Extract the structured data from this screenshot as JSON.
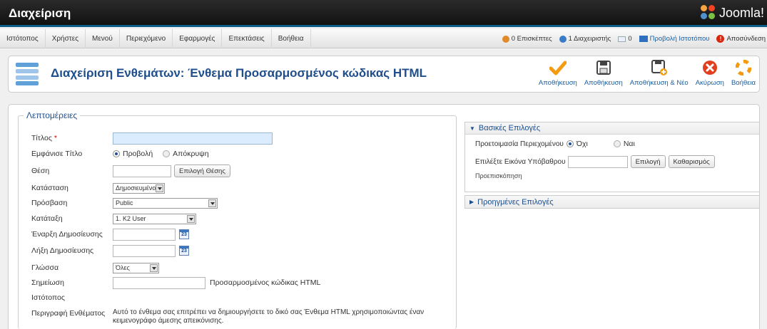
{
  "header": {
    "title": "Διαχείριση",
    "logo_text": "Joomla!"
  },
  "menu": [
    "Ιστότοπος",
    "Χρήστες",
    "Μενού",
    "Περιεχόμενο",
    "Εφαρμογές",
    "Επεκτάσεις",
    "Βοήθεια"
  ],
  "status": {
    "visitors": "0 Επισκέπτες",
    "admins": "1 Διαχειριστής",
    "messages": "0",
    "preview": "Προβολή Ιστοτόπου",
    "logout": "Αποσύνδεση"
  },
  "toolbar": {
    "page_title": "Διαχείριση Ενθεμάτων: Ένθεμα Προσαρμοσμένος κώδικας HTML",
    "buttons": [
      {
        "label": "Αποθήκευση",
        "icon": "save-close-icon"
      },
      {
        "label": "Αποθήκευση",
        "icon": "save-icon"
      },
      {
        "label": "Αποθήκευση & Νέο",
        "icon": "save-new-icon"
      },
      {
        "label": "Ακύρωση",
        "icon": "cancel-icon"
      },
      {
        "label": "Βοήθεια",
        "icon": "help-icon"
      }
    ]
  },
  "details": {
    "legend": "Λεπτομέρειες",
    "title_label": "Τίτλος",
    "required_mark": "*",
    "show_title_label": "Εμφάνισε Τίτλο",
    "show_option": "Προβολή",
    "hide_option": "Απόκρυψη",
    "position_label": "Θέση",
    "position_button": "Επιλογή Θέσης",
    "state_label": "Κατάσταση",
    "state_value": "Δημοσιευμένο",
    "access_label": "Πρόσβαση",
    "access_value": "Public",
    "order_label": "Κατάταξη",
    "order_value": "1. K2 User",
    "publish_up_label": "Έναρξη Δημοσίευσης",
    "publish_down_label": "Λήξη Δημοσίευσης",
    "calendar_day": "23",
    "language_label": "Γλώσσα",
    "language_value": "Όλες",
    "note_label": "Σημείωση",
    "module_type": "Προσαρμοσμένος κώδικας HTML",
    "site_label": "Ιστότοπος",
    "description_label": "Περιγραφή Ενθέματος",
    "description_text": "Αυτό το ένθεμα σας επιτρέπει να δημιουργήσετε το δικό σας Ένθεμα HTML χρησιμοποιώντας έναν κειμενογράφο άμεσης απεικόνισης."
  },
  "basic_options": {
    "title": "Βασικές Επιλογές",
    "prepare_label": "Προετοιμασία Περιεχομένου",
    "no_option": "Όχι",
    "yes_option": "Ναι",
    "bg_image_label": "Επιλέξτε Εικόνα Υπόβαθρου",
    "select_button": "Επιλογή",
    "clear_button": "Καθαρισμός",
    "preview_label": "Προεπισκόπηση"
  },
  "advanced_options": {
    "title": "Προηγμένες Επιλογές"
  },
  "colors": {
    "brand_blue": "#1f4e8c",
    "header_bg": "#111111",
    "accent_bar": "#0b5f8a"
  }
}
